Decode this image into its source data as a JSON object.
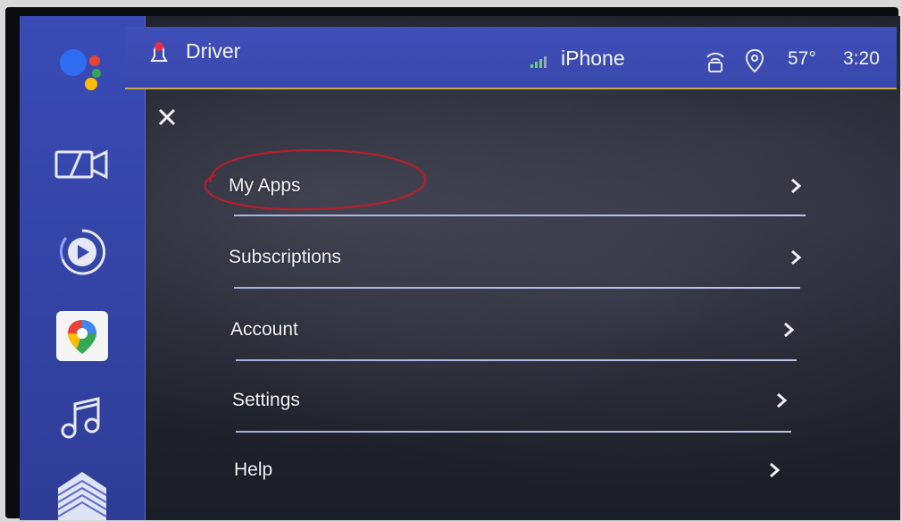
{
  "status_bar": {
    "profile_name": "Driver",
    "phone_name": "iPhone",
    "temperature": "57°",
    "time": "3:20"
  },
  "menu": {
    "items": [
      {
        "label": "My Apps"
      },
      {
        "label": "Subscriptions"
      },
      {
        "label": "Account"
      },
      {
        "label": "Settings"
      },
      {
        "label": "Help"
      }
    ]
  },
  "colors": {
    "rail_blue": "#3b4bb6",
    "accent_gold": "#c9a84a",
    "annotation_red": "#b3202a"
  },
  "rail": {
    "icons": [
      "google-assistant-icon",
      "camera-icon",
      "play-icon",
      "google-maps-icon",
      "music-note-icon",
      "building-icon"
    ]
  }
}
